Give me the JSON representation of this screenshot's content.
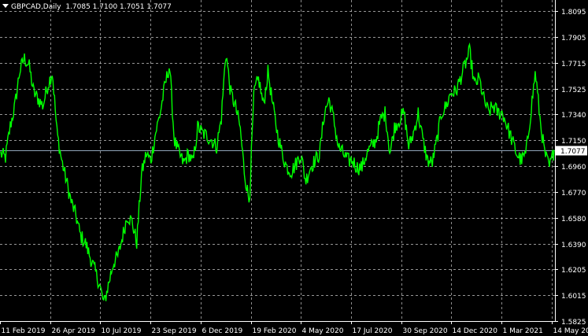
{
  "header": {
    "symbol": "GBPCAD,Daily",
    "ohlc": "1.7085 1.7100 1.7051 1.7077"
  },
  "colors": {
    "background": "#000000",
    "series": "#00ff00",
    "grid": "#c8c8c8",
    "current_price_line": "#8fa3b8",
    "text": "#ffffff"
  },
  "chart_data": {
    "type": "line",
    "title": "GBPCAD,Daily",
    "xlabel": "",
    "ylabel": "",
    "ylim": [
      1.5825,
      1.8095
    ],
    "grid": true,
    "y_ticks": [
      "1.8095",
      "1.7905",
      "1.7715",
      "1.7525",
      "1.7340",
      "1.7150",
      "1.6960",
      "1.6770",
      "1.6580",
      "1.6390",
      "1.6205",
      "1.6015",
      "1.5825"
    ],
    "x_ticks": [
      "11 Feb 2019",
      "26 Apr 2019",
      "10 Jul 2019",
      "23 Sep 2019",
      "6 Dec 2019",
      "19 Feb 2020",
      "4 May 2020",
      "17 Jul 2020",
      "30 Sep 2020",
      "14 Dec 2020",
      "1 Mar 2021",
      "14 May 2021"
    ],
    "current_price": "1.7077",
    "series": [
      {
        "x": [
          "2019-02-11",
          "2019-02-18",
          "2019-02-25",
          "2019-03-04",
          "2019-03-11",
          "2019-03-18",
          "2019-03-25",
          "2019-04-01",
          "2019-04-08",
          "2019-04-15",
          "2019-04-22",
          "2019-04-29",
          "2019-05-06",
          "2019-05-13",
          "2019-05-20",
          "2019-05-27",
          "2019-06-03",
          "2019-06-10",
          "2019-06-17",
          "2019-06-24",
          "2019-07-01",
          "2019-07-08",
          "2019-07-15",
          "2019-07-22",
          "2019-07-29",
          "2019-08-05",
          "2019-08-12",
          "2019-08-19",
          "2019-08-26",
          "2019-09-02",
          "2019-09-09",
          "2019-09-16",
          "2019-09-23",
          "2019-09-30",
          "2019-10-07",
          "2019-10-14",
          "2019-10-21",
          "2019-10-28",
          "2019-11-04",
          "2019-11-11",
          "2019-11-18",
          "2019-11-25",
          "2019-12-02",
          "2019-12-09",
          "2019-12-16",
          "2019-12-23",
          "2019-12-30",
          "2020-01-06",
          "2020-01-13",
          "2020-01-20",
          "2020-01-27",
          "2020-02-03",
          "2020-02-10",
          "2020-02-17",
          "2020-02-24",
          "2020-03-02",
          "2020-03-09",
          "2020-03-16",
          "2020-03-23",
          "2020-03-30",
          "2020-04-06",
          "2020-04-13",
          "2020-04-20",
          "2020-04-27",
          "2020-05-04",
          "2020-05-11",
          "2020-05-18",
          "2020-05-25",
          "2020-06-01",
          "2020-06-08",
          "2020-06-15",
          "2020-06-22",
          "2020-06-29",
          "2020-07-06",
          "2020-07-13",
          "2020-07-20",
          "2020-07-27",
          "2020-08-03",
          "2020-08-10",
          "2020-08-17",
          "2020-08-24",
          "2020-08-31",
          "2020-09-07",
          "2020-09-14",
          "2020-09-21",
          "2020-09-28",
          "2020-10-05",
          "2020-10-12",
          "2020-10-19",
          "2020-10-26",
          "2020-11-02",
          "2020-11-09",
          "2020-11-16",
          "2020-11-23",
          "2020-11-30",
          "2020-12-07",
          "2020-12-14",
          "2020-12-21",
          "2020-12-28",
          "2021-01-04",
          "2021-01-11",
          "2021-01-18",
          "2021-01-25",
          "2021-02-01",
          "2021-02-08",
          "2021-02-15",
          "2021-02-22",
          "2021-03-01",
          "2021-03-08",
          "2021-03-15",
          "2021-03-22",
          "2021-03-29",
          "2021-04-05",
          "2021-04-12",
          "2021-04-19",
          "2021-04-26",
          "2021-05-03",
          "2021-05-10",
          "2021-05-17"
        ],
        "values": [
          1.705,
          1.702,
          1.725,
          1.74,
          1.765,
          1.775,
          1.77,
          1.75,
          1.745,
          1.74,
          1.755,
          1.765,
          1.72,
          1.7,
          1.685,
          1.67,
          1.66,
          1.645,
          1.64,
          1.63,
          1.62,
          1.61,
          1.595,
          1.61,
          1.625,
          1.63,
          1.645,
          1.66,
          1.655,
          1.64,
          1.69,
          1.705,
          1.7,
          1.72,
          1.735,
          1.755,
          1.77,
          1.715,
          1.705,
          1.698,
          1.705,
          1.698,
          1.725,
          1.72,
          1.718,
          1.715,
          1.71,
          1.73,
          1.78,
          1.75,
          1.74,
          1.725,
          1.69,
          1.67,
          1.75,
          1.76,
          1.74,
          1.765,
          1.74,
          1.72,
          1.705,
          1.695,
          1.692,
          1.698,
          1.705,
          1.685,
          1.695,
          1.7,
          1.705,
          1.735,
          1.745,
          1.73,
          1.71,
          1.705,
          1.7,
          1.7,
          1.695,
          1.695,
          1.705,
          1.71,
          1.715,
          1.73,
          1.735,
          1.705,
          1.725,
          1.73,
          1.735,
          1.71,
          1.72,
          1.735,
          1.715,
          1.7,
          1.698,
          1.715,
          1.735,
          1.74,
          1.75,
          1.75,
          1.76,
          1.77,
          1.78,
          1.755,
          1.76,
          1.745,
          1.735,
          1.74,
          1.735,
          1.735,
          1.725,
          1.715,
          1.705,
          1.7,
          1.705,
          1.735,
          1.765,
          1.73,
          1.705,
          1.695,
          1.7077
        ]
      }
    ]
  }
}
